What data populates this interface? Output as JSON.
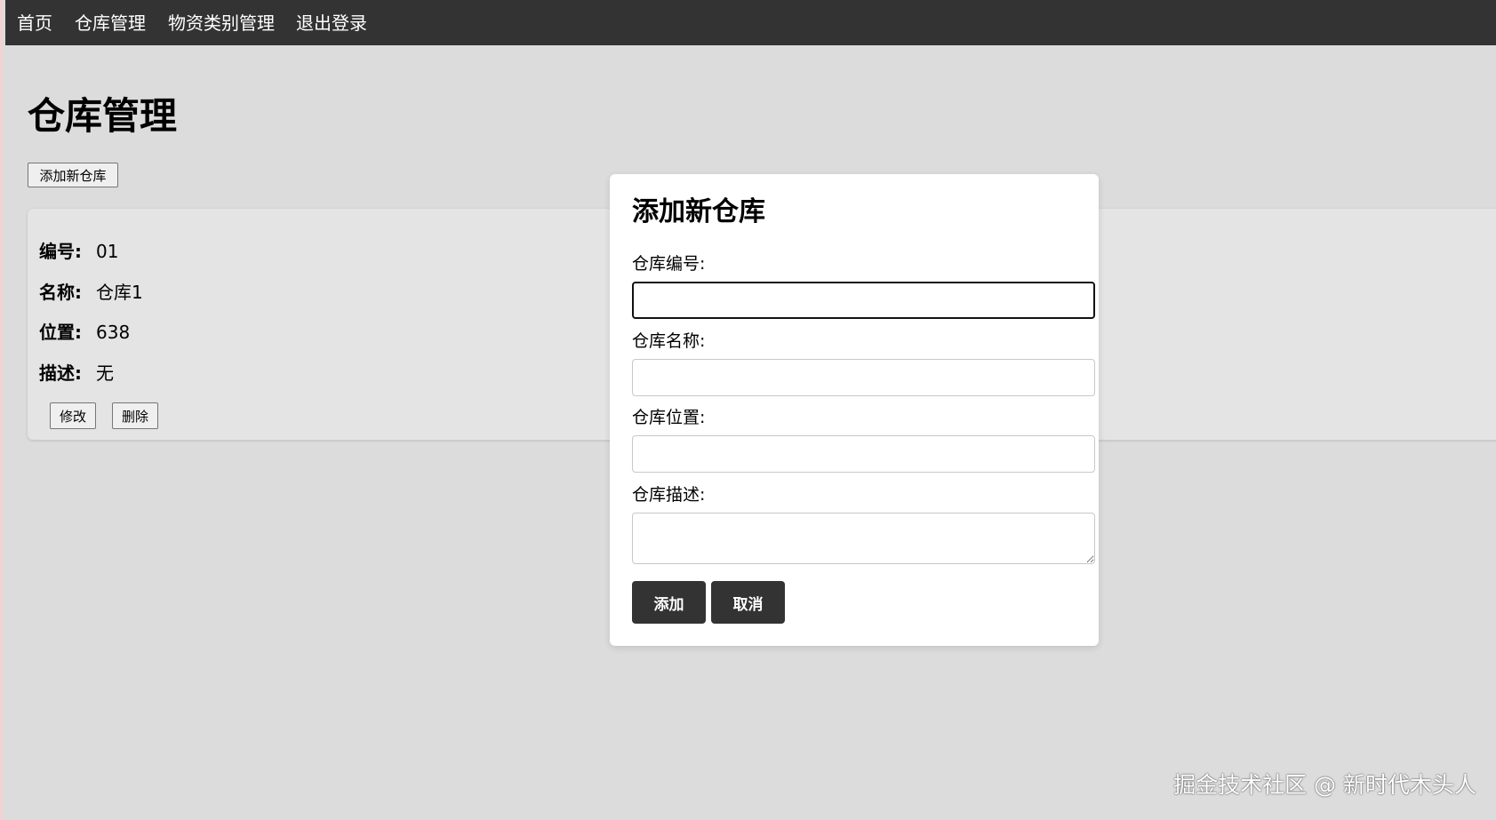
{
  "nav": {
    "items": [
      {
        "label": "首页"
      },
      {
        "label": "仓库管理"
      },
      {
        "label": "物资类别管理"
      },
      {
        "label": "退出登录"
      }
    ]
  },
  "page": {
    "title": "仓库管理",
    "add_button_label": "添加新仓库"
  },
  "warehouse": {
    "id_label": "编号:",
    "id_value": "01",
    "name_label": "名称:",
    "name_value": "仓库1",
    "location_label": "位置:",
    "location_value": "638",
    "description_label": "描述:",
    "description_value": "无",
    "edit_label": "修改",
    "delete_label": "删除"
  },
  "modal": {
    "title": "添加新仓库",
    "fields": {
      "id_label": "仓库编号:",
      "id_value": "",
      "name_label": "仓库名称:",
      "name_value": "",
      "location_label": "仓库位置:",
      "location_value": "",
      "description_label": "仓库描述:",
      "description_value": ""
    },
    "submit_label": "添加",
    "cancel_label": "取消"
  },
  "watermark": {
    "text": "掘金技术社区 @ 新时代木头人"
  },
  "colors": {
    "navbar": "#333333",
    "page_background": "#dcdcdc",
    "card_background": "#e4e4e4",
    "modal_background": "#ffffff",
    "primary_button": "#333333"
  }
}
